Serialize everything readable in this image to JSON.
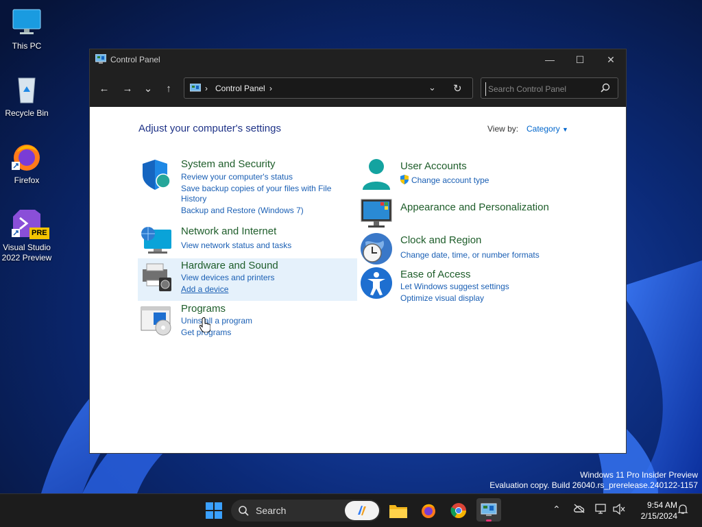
{
  "desktop": {
    "icons": [
      {
        "label": "This PC",
        "icon": "monitor-icon"
      },
      {
        "label": "Recycle Bin",
        "icon": "recycle-bin-icon"
      },
      {
        "label": "Firefox",
        "icon": "firefox-icon"
      },
      {
        "label": "Visual Studio 2022 Preview",
        "icon": "visual-studio-icon",
        "badge": "PRE"
      }
    ],
    "watermark": {
      "line1": "Windows 11 Pro Insider Preview",
      "line2": "Evaluation copy. Build 26040.rs_prerelease.240122-1157"
    }
  },
  "window": {
    "title": "Control Panel",
    "controls": {
      "minimize": "—",
      "maximize": "☐",
      "close": "✕"
    },
    "nav": {
      "back": "←",
      "forward": "→",
      "recent": "⌄",
      "up": "↑"
    },
    "address": {
      "separator": "›",
      "crumb": "Control Panel",
      "trailing": "›"
    },
    "search": {
      "placeholder": "Search Control Panel"
    }
  },
  "content": {
    "heading": "Adjust your computer's settings",
    "view_by_label": "View by:",
    "view_by_value": "Category",
    "categories": [
      {
        "title": "System and Security",
        "icon": "shield-icon",
        "links": [
          "Review your computer's status",
          "Save backup copies of your files with File",
          "History",
          "Backup and Restore (Windows 7)"
        ]
      },
      {
        "title": "Network and Internet",
        "icon": "network-icon",
        "links": [
          "View network status and tasks"
        ]
      },
      {
        "title": "Hardware and Sound",
        "icon": "printer-icon",
        "links": [
          "View devices and printers",
          "Add a device"
        ]
      },
      {
        "title": "Programs",
        "icon": "programs-icon",
        "links": [
          "Uninstall a program",
          "Get programs"
        ]
      },
      {
        "title": "User Accounts",
        "icon": "user-icon",
        "links": [
          "Change account type"
        ]
      },
      {
        "title": "Appearance and Personalization",
        "icon": "appearance-icon",
        "links": []
      },
      {
        "title": "Clock and Region",
        "icon": "clock-icon",
        "links": [
          "Change date, time, or number formats"
        ]
      },
      {
        "title": "Ease of Access",
        "icon": "accessibility-icon",
        "links": [
          "Let Windows suggest settings",
          "Optimize visual display"
        ]
      }
    ]
  },
  "taskbar": {
    "search_label": "Search",
    "apps": [
      "start-icon",
      "copilot-icon",
      "file-explorer-icon",
      "firefox-icon",
      "chrome-icon",
      "control-panel-icon"
    ],
    "clock": {
      "time": "9:54 AM",
      "date": "2/15/2024"
    }
  },
  "colors": {
    "accent": "#1a5fb4",
    "category_title": "#1e5d2a",
    "heading": "#1e3287",
    "highlight": "#e5f1fb"
  }
}
